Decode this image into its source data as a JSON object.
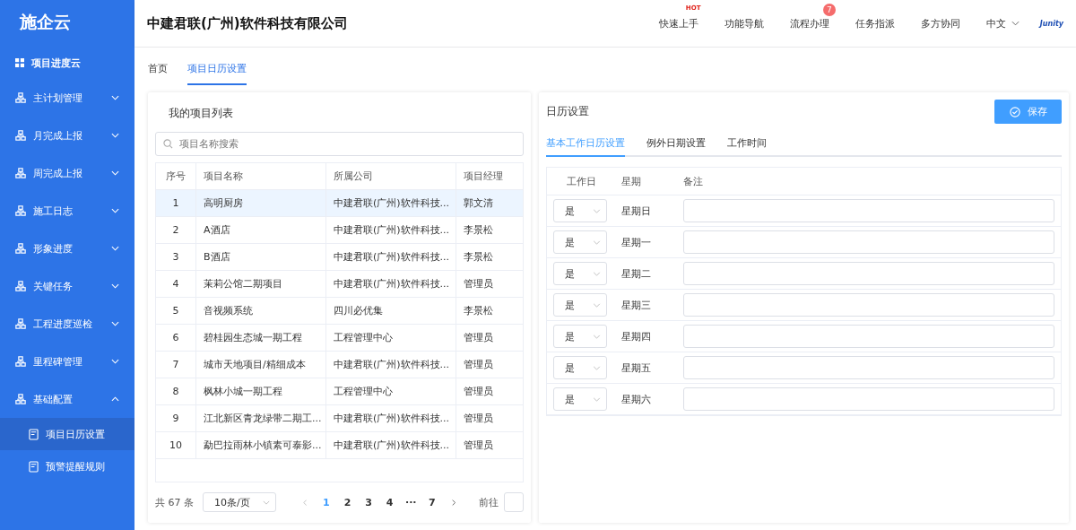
{
  "sidebar": {
    "logo": "施企云",
    "home": "项目进度云",
    "items": [
      {
        "label": "主计划管理",
        "expanded": false
      },
      {
        "label": "月完成上报",
        "expanded": false
      },
      {
        "label": "周完成上报",
        "expanded": false
      },
      {
        "label": "施工日志",
        "expanded": false
      },
      {
        "label": "形象进度",
        "expanded": false
      },
      {
        "label": "关键任务",
        "expanded": false
      },
      {
        "label": "工程进度巡检",
        "expanded": false
      },
      {
        "label": "里程碑管理",
        "expanded": false
      },
      {
        "label": "基础配置",
        "expanded": true,
        "children": [
          {
            "label": "项目日历设置",
            "selected": true
          },
          {
            "label": "预警提醒规则",
            "selected": false
          }
        ]
      }
    ]
  },
  "header": {
    "company": "中建君联(广州)软件科技有限公司",
    "nav": [
      {
        "label": "快速上手",
        "hot": "HOT"
      },
      {
        "label": "功能导航"
      },
      {
        "label": "流程办理",
        "badge": "7"
      },
      {
        "label": "任务指派"
      },
      {
        "label": "多方协同"
      }
    ],
    "language": "中文",
    "logo": "Junity"
  },
  "tabs": [
    {
      "label": "首页",
      "selected": false
    },
    {
      "label": "项目日历设置",
      "selected": true
    }
  ],
  "project_list": {
    "title": "我的项目列表",
    "search": {
      "placeholder": "项目名称搜索"
    },
    "columns": [
      "序号",
      "项目名称",
      "所属公司",
      "项目经理"
    ],
    "rows": [
      {
        "cells": [
          "1",
          "高明厨房",
          "中建君联(广州)软件科技...",
          "郭文清"
        ],
        "selected": true
      },
      {
        "cells": [
          "2",
          "A酒店",
          "中建君联(广州)软件科技...",
          "李景松"
        ],
        "selected": false
      },
      {
        "cells": [
          "3",
          "B酒店",
          "中建君联(广州)软件科技...",
          "李景松"
        ],
        "selected": false
      },
      {
        "cells": [
          "4",
          "茉莉公馆二期项目",
          "中建君联(广州)软件科技...",
          "管理员"
        ],
        "selected": false
      },
      {
        "cells": [
          "5",
          "音视频系统",
          "四川必优集",
          "李景松"
        ],
        "selected": false
      },
      {
        "cells": [
          "6",
          "碧桂园生态城一期工程",
          "工程管理中心",
          "管理员"
        ],
        "selected": false
      },
      {
        "cells": [
          "7",
          "城市天地项目/精细成本",
          "中建君联(广州)软件科技...",
          "管理员"
        ],
        "selected": false
      },
      {
        "cells": [
          "8",
          "枫林小城一期工程",
          "工程管理中心",
          "管理员"
        ],
        "selected": false
      },
      {
        "cells": [
          "9",
          "江北新区青龙绿带二期工...",
          "中建君联(广州)软件科技...",
          "管理员"
        ],
        "selected": false
      },
      {
        "cells": [
          "10",
          "勐巴拉雨林小镇素可泰影...",
          "中建君联(广州)软件科技...",
          "管理员"
        ],
        "selected": false
      }
    ],
    "pagination": {
      "total": "共 67 条",
      "page_size": "10条/页",
      "pages": [
        {
          "label": "1",
          "selected": true
        },
        {
          "label": "2",
          "selected": false
        },
        {
          "label": "3",
          "selected": false
        },
        {
          "label": "4",
          "selected": false
        },
        {
          "label": "···",
          "selected": false
        },
        {
          "label": "7",
          "selected": false
        }
      ],
      "goto": "前往"
    }
  },
  "calendar": {
    "title": "日历设置",
    "save": "保存",
    "tabs": [
      {
        "label": "基本工作日历设置",
        "selected": true
      },
      {
        "label": "例外日期设置",
        "selected": false
      },
      {
        "label": "工作时间",
        "selected": false
      }
    ],
    "columns": [
      "工作日",
      "星期",
      "备注"
    ],
    "rows": [
      {
        "workday": "是",
        "weekday": "星期日"
      },
      {
        "workday": "是",
        "weekday": "星期一"
      },
      {
        "workday": "是",
        "weekday": "星期二"
      },
      {
        "workday": "是",
        "weekday": "星期三"
      },
      {
        "workday": "是",
        "weekday": "星期四"
      },
      {
        "workday": "是",
        "weekday": "星期五"
      },
      {
        "workday": "是",
        "weekday": "星期六"
      }
    ]
  }
}
